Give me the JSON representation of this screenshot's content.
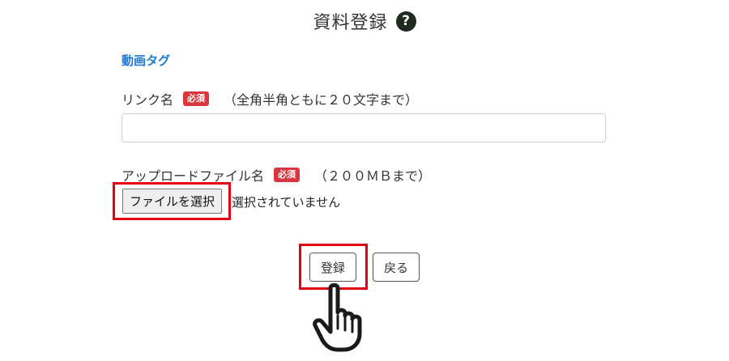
{
  "header": {
    "title": "資料登録",
    "help_icon": "question-circle-icon",
    "help_glyph": "?"
  },
  "tag_link": "動画タグ",
  "link_name": {
    "label": "リンク名",
    "badge": "必須",
    "hint": "（全角半角ともに２０文字まで）",
    "value": ""
  },
  "upload": {
    "label": "アップロードファイル名",
    "badge": "必須",
    "hint": "（２００ＭＢまで）",
    "button_label": "ファイルを選択",
    "status": "選択されていません"
  },
  "actions": {
    "submit_label": "登録",
    "back_label": "戻る"
  },
  "annotations": {
    "highlight_color": "#e60012",
    "pointer_icon": "hand-pointer-icon"
  },
  "colors": {
    "link": "#1e7ad4",
    "badge": "#d9363e",
    "help_icon_bg": "#1c2b1e"
  }
}
